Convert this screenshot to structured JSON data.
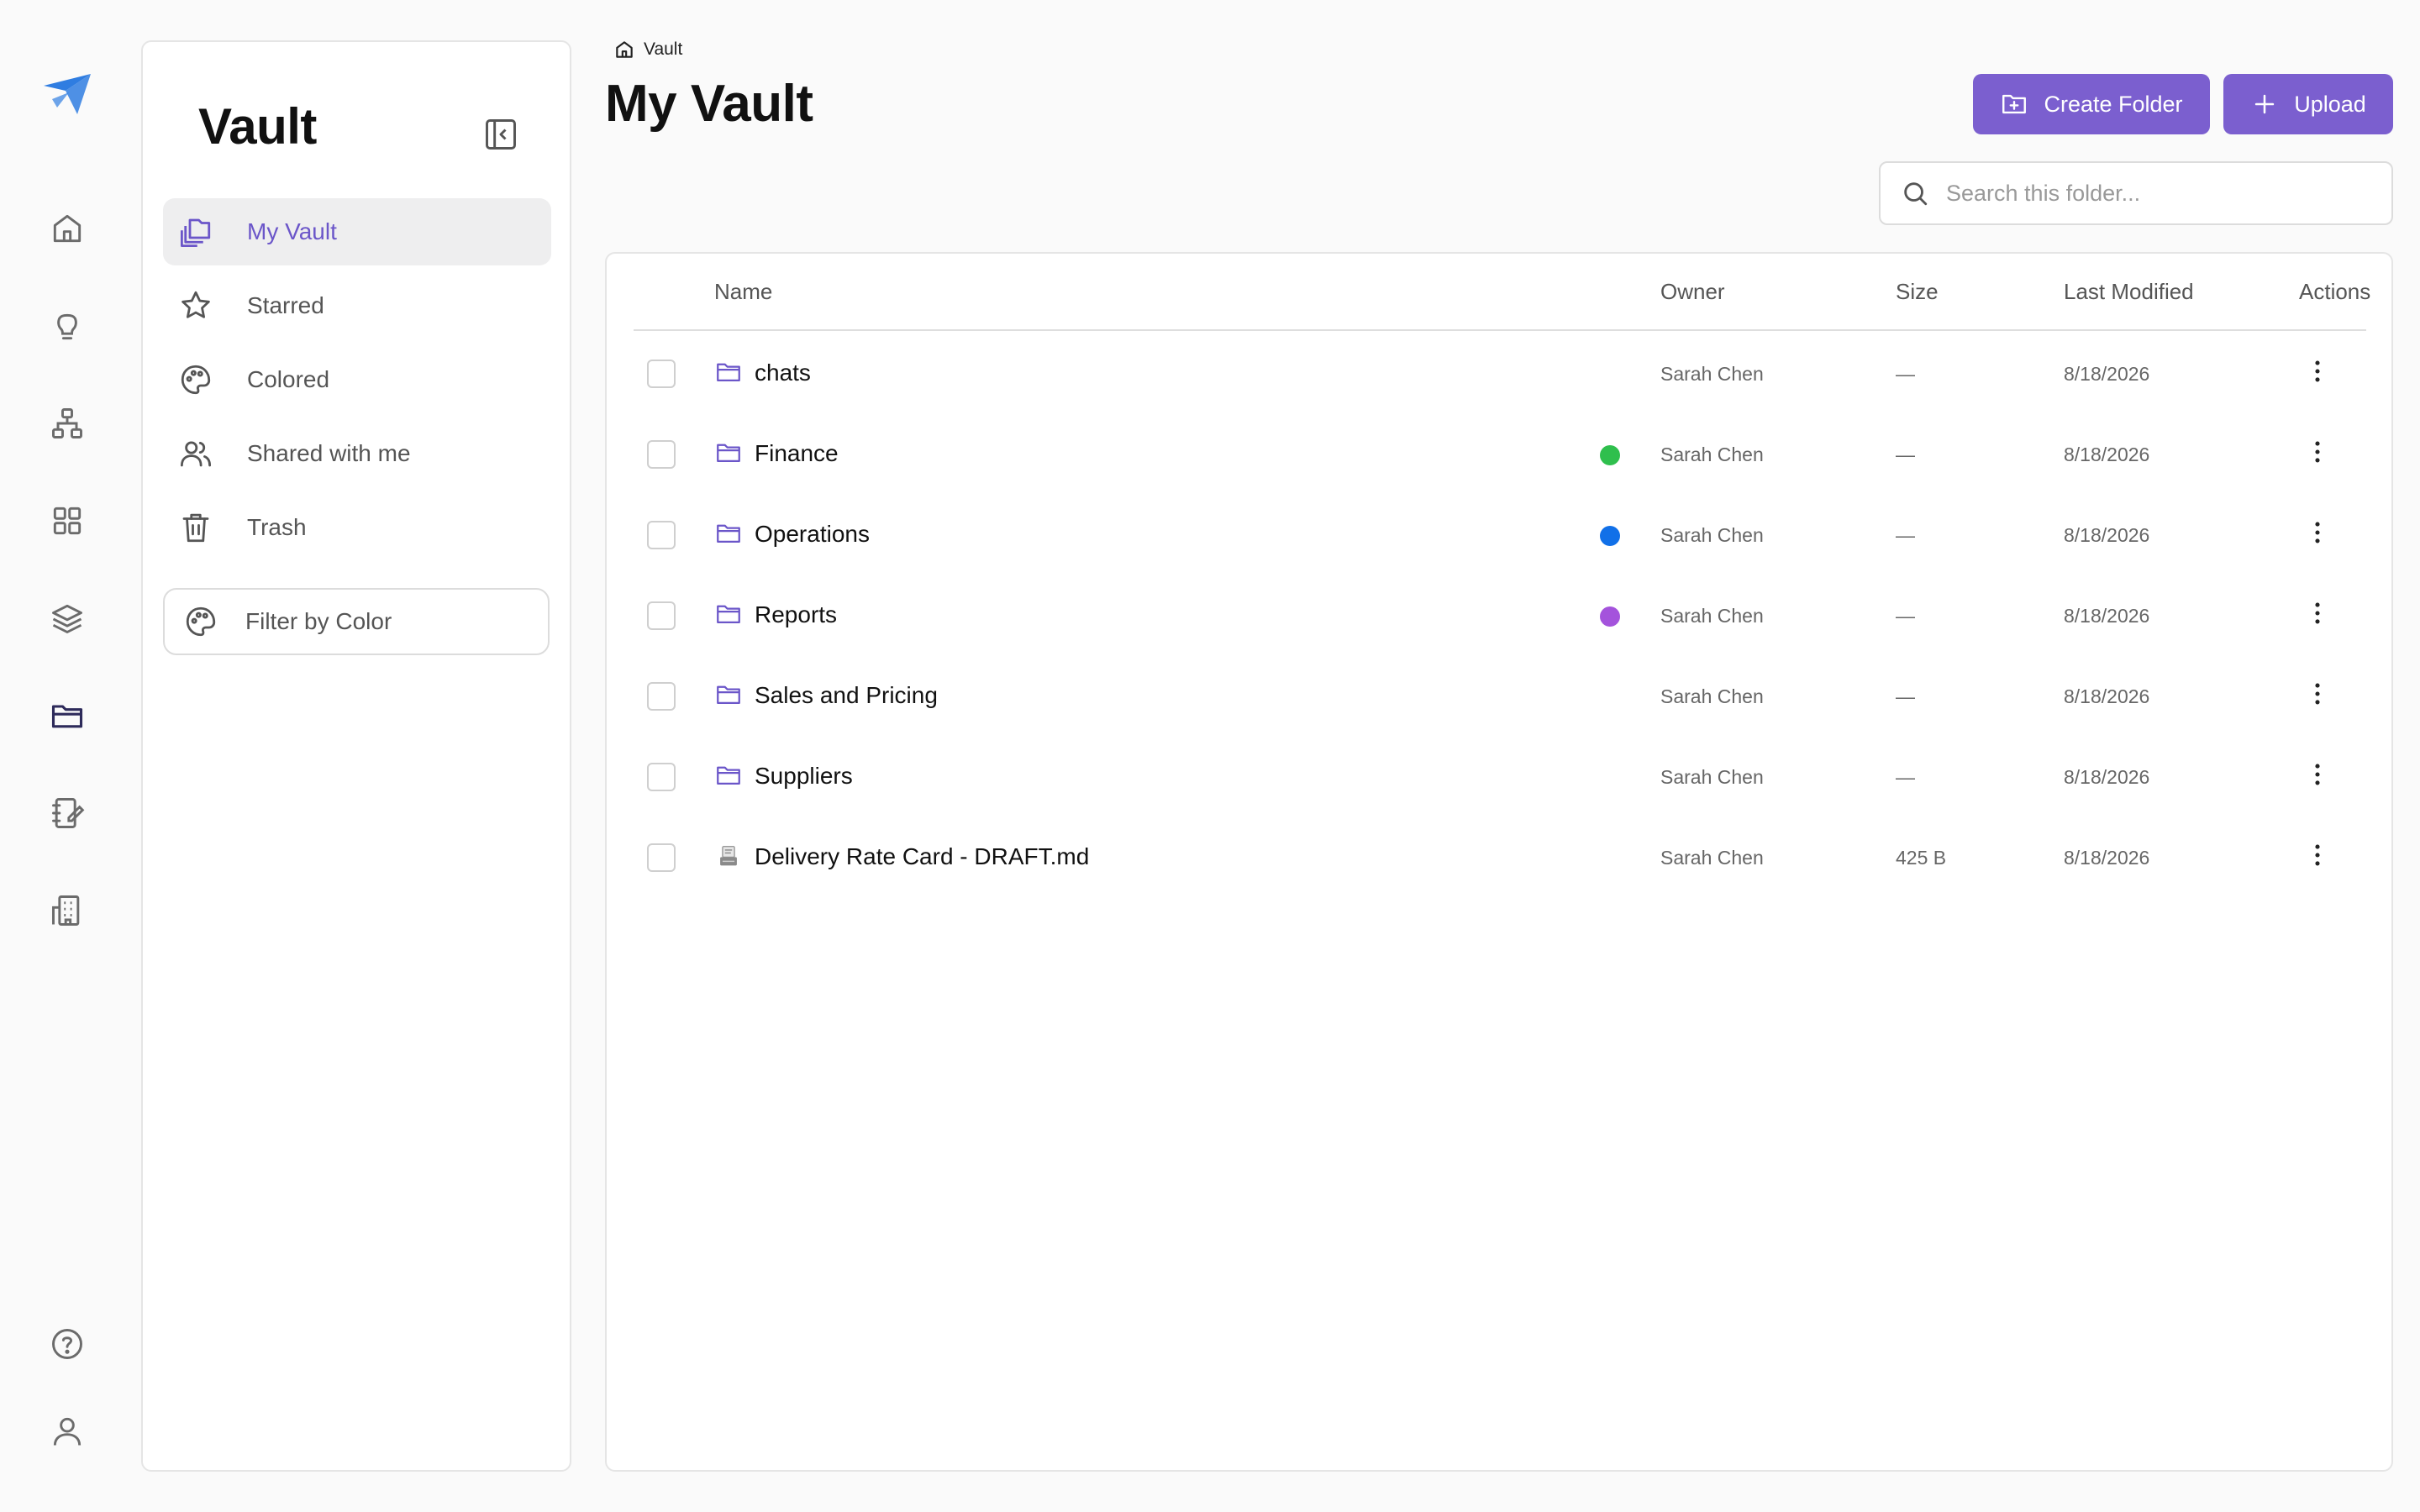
{
  "colors": {
    "accent": "#7b5fcf",
    "active_nav_text": "#6b56c9",
    "rail_icon": "#6b6b6b",
    "rail_active_icon": "#2d2a5a",
    "logo": "#2f7de1",
    "dot_green": "#2fbf4d",
    "dot_blue": "#1170e8",
    "dot_purple": "#a453dc"
  },
  "rail": {
    "items": [
      {
        "icon": "home-icon"
      },
      {
        "icon": "lightbulb-icon"
      },
      {
        "icon": "hierarchy-icon"
      },
      {
        "icon": "apps-grid-icon"
      },
      {
        "icon": "layers-icon"
      },
      {
        "icon": "folder-icon",
        "active": true
      },
      {
        "icon": "notebook-edit-icon"
      },
      {
        "icon": "building-icon"
      }
    ],
    "bottom": [
      {
        "icon": "help-circle-icon"
      },
      {
        "icon": "user-icon"
      }
    ]
  },
  "sidebar": {
    "title": "Vault",
    "items": [
      {
        "label": "My Vault",
        "icon": "copy-files-icon",
        "active": true
      },
      {
        "label": "Starred",
        "icon": "star-icon"
      },
      {
        "label": "Colored",
        "icon": "palette-icon"
      },
      {
        "label": "Shared with me",
        "icon": "users-icon"
      },
      {
        "label": "Trash",
        "icon": "trash-icon"
      }
    ],
    "filter_label": "Filter by Color"
  },
  "header": {
    "breadcrumb": "Vault",
    "title": "My Vault",
    "create_folder_label": "Create Folder",
    "upload_label": "Upload"
  },
  "search": {
    "placeholder": "Search this folder...",
    "value": ""
  },
  "table": {
    "columns": {
      "name": "Name",
      "owner": "Owner",
      "size": "Size",
      "modified": "Last Modified",
      "actions": "Actions"
    },
    "rows": [
      {
        "name": "chats",
        "type": "folder",
        "color": null,
        "owner": "Sarah Chen",
        "size": "—",
        "modified": "8/18/2026"
      },
      {
        "name": "Finance",
        "type": "folder",
        "color": "#2fbf4d",
        "owner": "Sarah Chen",
        "size": "—",
        "modified": "8/18/2026"
      },
      {
        "name": "Operations",
        "type": "folder",
        "color": "#1170e8",
        "owner": "Sarah Chen",
        "size": "—",
        "modified": "8/18/2026"
      },
      {
        "name": "Reports",
        "type": "folder",
        "color": "#a453dc",
        "owner": "Sarah Chen",
        "size": "—",
        "modified": "8/18/2026"
      },
      {
        "name": "Sales and Pricing",
        "type": "folder",
        "color": null,
        "owner": "Sarah Chen",
        "size": "—",
        "modified": "8/18/2026"
      },
      {
        "name": "Suppliers",
        "type": "folder",
        "color": null,
        "owner": "Sarah Chen",
        "size": "—",
        "modified": "8/18/2026"
      },
      {
        "name": "Delivery Rate Card - DRAFT.md",
        "type": "file",
        "color": null,
        "owner": "Sarah Chen",
        "size": "425 B",
        "modified": "8/18/2026"
      }
    ]
  }
}
